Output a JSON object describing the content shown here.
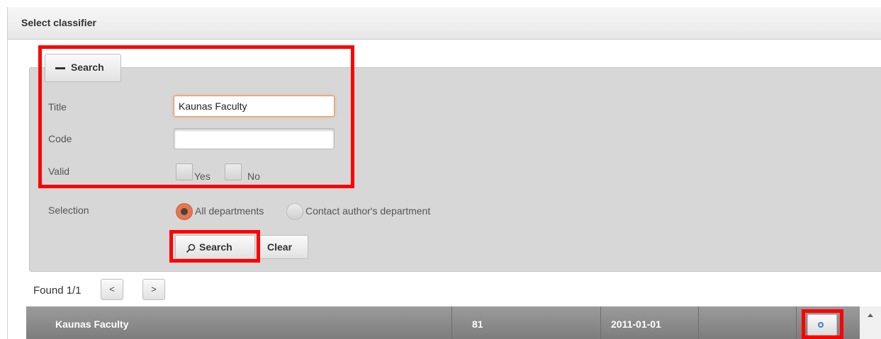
{
  "dialog": {
    "title": "Select classifier"
  },
  "search_toggle": {
    "label": "Search",
    "icon": "minus-icon"
  },
  "form": {
    "title": {
      "label": "Title",
      "value": "Kaunas Faculty"
    },
    "code": {
      "label": "Code",
      "value": ""
    },
    "valid": {
      "label": "Valid",
      "yes": "Yes",
      "no": "No"
    },
    "selection": {
      "label": "Selection",
      "options": [
        {
          "label": "All departments",
          "selected": true
        },
        {
          "label": "Contact author's department",
          "selected": false
        }
      ]
    }
  },
  "buttons": {
    "search": "Search",
    "clear": "Clear"
  },
  "pager": {
    "found": "Found 1/1",
    "prev": "<",
    "next": ">"
  },
  "results": {
    "rows": [
      {
        "title": "Kaunas Faculty",
        "code": "81",
        "date": "2011-01-01",
        "extra": ""
      }
    ]
  },
  "colors": {
    "highlight": "#ff0000",
    "radio_selected": "#e8754e",
    "panel_bg": "#d7d7d7"
  }
}
